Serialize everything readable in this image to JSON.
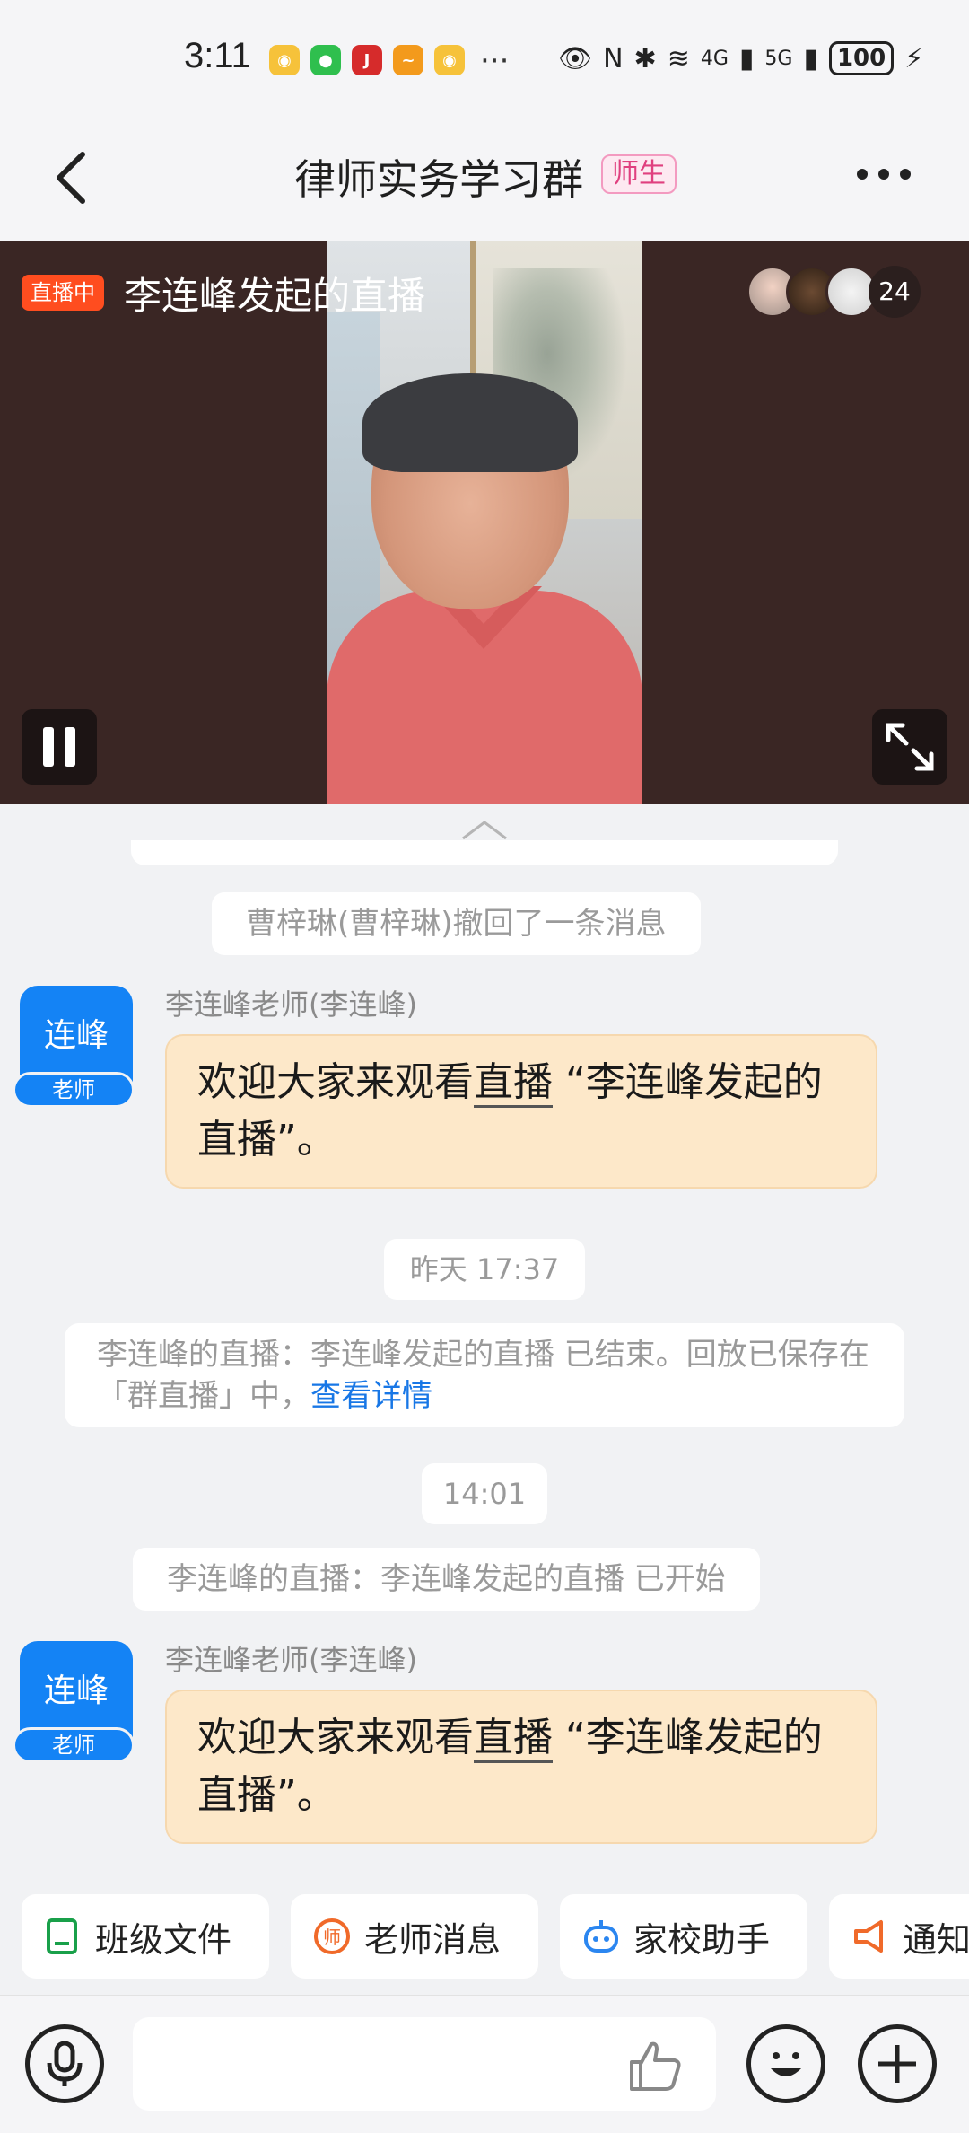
{
  "status_bar": {
    "time": "3:11",
    "more": "···",
    "network_1": "4G",
    "network_2": "5G",
    "battery": "100"
  },
  "header": {
    "back_icon": "chevron-left-icon",
    "title": "律师实务学习群",
    "badge": "师生",
    "more_icon": "more-horizontal-icon"
  },
  "live": {
    "status_badge": "直播中",
    "title": "李连峰发起的直播",
    "viewer_count": "24"
  },
  "messages": {
    "recall_notice": "曹梓琳(曹梓琳)撤回了一条消息",
    "msg1": {
      "avatar_name": "连峰",
      "avatar_role": "老师",
      "sender": "李连峰老师(李连峰)",
      "text_before": "欢迎大家来观看",
      "text_link": "直播",
      "text_after": "“李连峰发起的直播”。"
    },
    "time1": "昨天 17:37",
    "ended_notice_text": "李连峰的直播：李连峰发起的直播 已结束。回放已保存在「群直播」中，",
    "ended_notice_link": "查看详情",
    "time2": "14:01",
    "started_notice": "李连峰的直播：李连峰发起的直播 已开始",
    "msg2": {
      "avatar_name": "连峰",
      "avatar_role": "老师",
      "sender": "李连峰老师(李连峰)",
      "text_before": "欢迎大家来观看",
      "text_link": "直播",
      "text_after": "“李连峰发起的直播”。"
    }
  },
  "quick_actions": [
    {
      "label": "班级文件",
      "icon": "file-icon",
      "color": "#19a04a"
    },
    {
      "label": "老师消息",
      "icon": "teacher-message-icon",
      "color": "#f06a2a"
    },
    {
      "label": "家校助手",
      "icon": "robot-icon",
      "color": "#2b86f0"
    },
    {
      "label": "通知",
      "icon": "megaphone-icon",
      "color": "#f06a2a"
    }
  ],
  "colors": {
    "accent_blue": "#1483f5",
    "live_red": "#ff4d1f",
    "bubble": "#fde8c9"
  }
}
